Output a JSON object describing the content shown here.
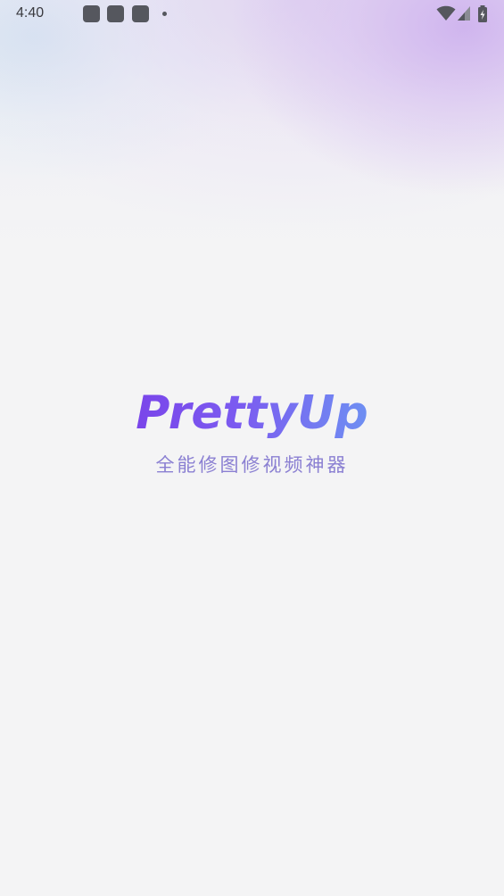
{
  "status_bar": {
    "time": "4:40",
    "notification_icons": [
      "app-notification-icon",
      "app-notification-icon",
      "app-notification-icon"
    ],
    "system_icons": [
      "wifi-icon",
      "cellular-signal-icon",
      "battery-charging-icon"
    ]
  },
  "splash": {
    "app_name": "PrettyUp",
    "tagline": "全能修图修视频神器"
  },
  "colors": {
    "background": "#f4f4f5",
    "brand_gradient_start": "#7a45ea",
    "brand_gradient_end": "#6e8ff2",
    "tagline": "#8a7fd2"
  }
}
